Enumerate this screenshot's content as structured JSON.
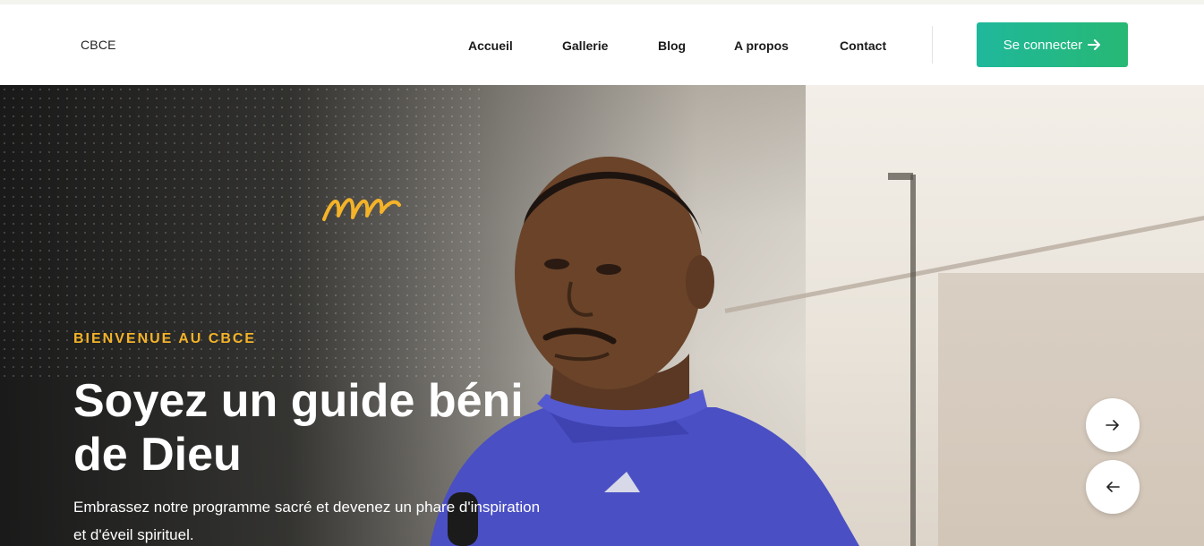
{
  "brand": "CBCE",
  "nav": [
    {
      "label": "Accueil"
    },
    {
      "label": "Gallerie"
    },
    {
      "label": "Blog"
    },
    {
      "label": "A propos"
    },
    {
      "label": "Contact"
    }
  ],
  "cta_label": "Se connecter",
  "hero": {
    "eyebrow": "BIENVENUE AU CBCE",
    "title_line1": "Soyez un guide béni",
    "title_line2": "de Dieu",
    "lead_line1": "Embrassez notre programme sacré et devenez un phare d'inspiration",
    "lead_line2": "et d'éveil spirituel."
  },
  "colors": {
    "accent_green": "#1fb89b",
    "accent_yellow": "#f4b328",
    "robe_blue": "#4a4fc4"
  },
  "icons": {
    "cta": "arrow-right-icon",
    "next": "arrow-right-icon",
    "prev": "arrow-left-icon"
  }
}
